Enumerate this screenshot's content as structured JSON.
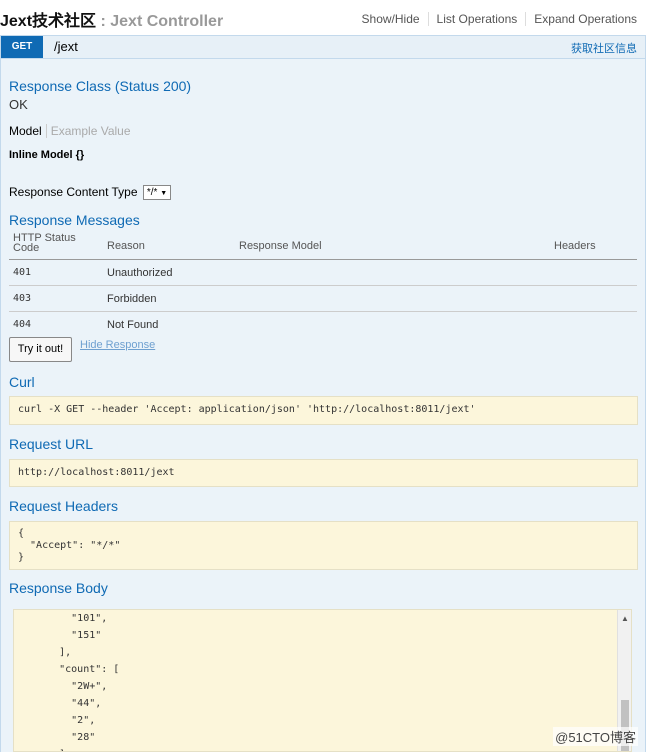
{
  "header": {
    "title_prefix": "Jext技术社区",
    "title_sep": " : ",
    "title_controller": "Jext Controller",
    "links": [
      "Show/Hide",
      "List Operations",
      "Expand Operations"
    ]
  },
  "operation": {
    "method": "GET",
    "path": "/jext",
    "summary": "获取社区信息"
  },
  "response_class": {
    "heading": "Response Class (Status 200)",
    "status_text": "OK",
    "tab_model": "Model",
    "tab_example": "Example Value",
    "model": "Inline Model {}"
  },
  "content_type": {
    "label": "Response Content Type",
    "value": "*/*"
  },
  "response_messages": {
    "heading": "Response Messages",
    "headers": [
      "HTTP Status Code",
      "Reason",
      "Response Model",
      "Headers"
    ],
    "rows": [
      {
        "code": "401",
        "reason": "Unauthorized"
      },
      {
        "code": "403",
        "reason": "Forbidden"
      },
      {
        "code": "404",
        "reason": "Not Found"
      }
    ]
  },
  "actions": {
    "try_label": "Try it out!",
    "hide_label": "Hide Response"
  },
  "curl": {
    "heading": "Curl",
    "command": "curl -X GET --header 'Accept: application/json' 'http://localhost:8011/jext'"
  },
  "request_url": {
    "heading": "Request URL",
    "url": "http://localhost:8011/jext"
  },
  "request_headers": {
    "heading": "Request Headers",
    "body": "{\n  \"Accept\": \"*/*\"\n}"
  },
  "response_body": {
    "heading": "Response Body",
    "text": "        \"101\",\n        \"151\"\n      ],\n      \"count\": [\n        \"2W+\",\n        \"44\",\n        \"2\",\n        \"28\"\n      ]"
  },
  "watermark": "@51CTO博客"
}
